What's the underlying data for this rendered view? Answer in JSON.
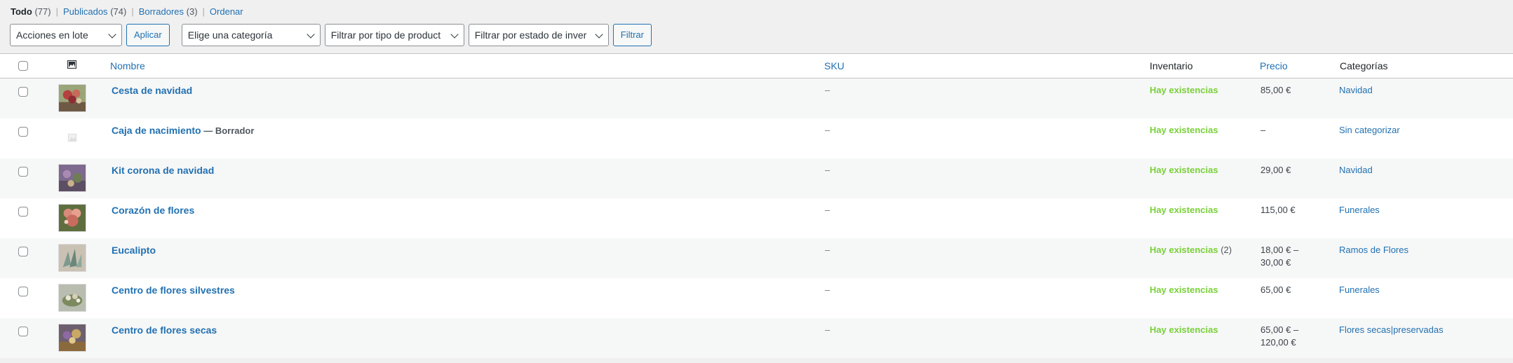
{
  "views": {
    "all_label": "Todo",
    "all_count": "(77)",
    "published_label": "Publicados",
    "published_count": "(74)",
    "drafts_label": "Borradores",
    "drafts_count": "(3)",
    "sort_label": "Ordenar",
    "separator": "|"
  },
  "filters": {
    "bulk_actions": "Acciones en lote",
    "apply": "Aplicar",
    "category": "Elige una categoría",
    "product_type": "Filtrar por tipo de product",
    "stock_status": "Filtrar por estado de inver",
    "filter": "Filtrar"
  },
  "columns": {
    "name": "Nombre",
    "sku": "SKU",
    "stock": "Inventario",
    "price": "Precio",
    "categories": "Categorías"
  },
  "products": [
    {
      "name": "Cesta de navidad",
      "state": "",
      "sku": "–",
      "stock": "Hay existencias",
      "qty": "",
      "price": "85,00 €",
      "category": "Navidad"
    },
    {
      "name": "Caja de nacimiento",
      "state": " — Borrador",
      "sku": "–",
      "stock": "Hay existencias",
      "qty": "",
      "price": "–",
      "category": "Sin categorizar"
    },
    {
      "name": "Kit corona de navidad",
      "state": "",
      "sku": "–",
      "stock": "Hay existencias",
      "qty": "",
      "price": "29,00 €",
      "category": "Navidad"
    },
    {
      "name": "Corazón de flores",
      "state": "",
      "sku": "–",
      "stock": "Hay existencias",
      "qty": "",
      "price": "115,00 €",
      "category": "Funerales"
    },
    {
      "name": "Eucalipto",
      "state": "",
      "sku": "–",
      "stock": "Hay existencias",
      "qty": " (2)",
      "price": "18,00 € – 30,00 €",
      "category": "Ramos de Flores"
    },
    {
      "name": "Centro de flores silvestres",
      "state": "",
      "sku": "–",
      "stock": "Hay existencias",
      "qty": "",
      "price": "65,00 €",
      "category": "Funerales"
    },
    {
      "name": "Centro de flores secas",
      "state": "",
      "sku": "–",
      "stock": "Hay existencias",
      "qty": "",
      "price": "65,00 € – 120,00 €",
      "category": "Flores secas|preservadas"
    }
  ],
  "colors": {
    "link": "#2271b1",
    "in_stock": "#7ad03a",
    "border": "#c3c4c7",
    "row_alt": "#f6f7f7"
  },
  "icons": {
    "thumbnail_column": "image-icon",
    "dropdown": "chevron-down-icon",
    "placeholder": "image-placeholder-icon"
  }
}
